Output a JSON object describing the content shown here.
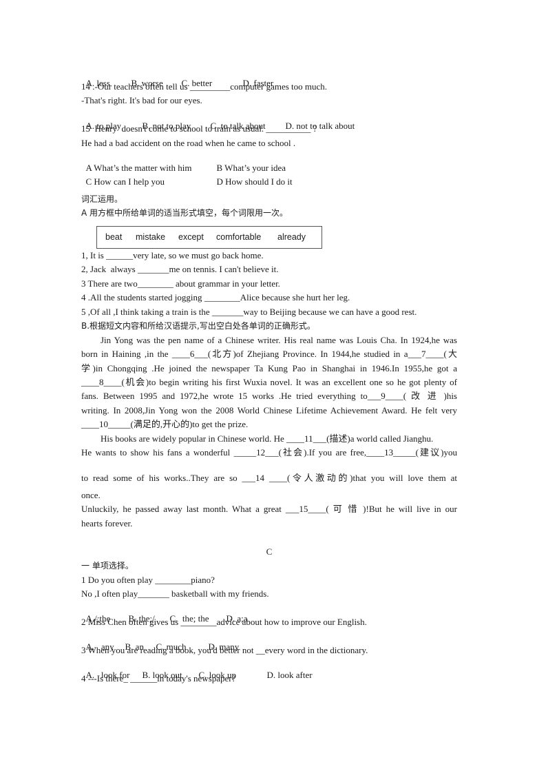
{
  "section_prev": {
    "q13_options": [
      "A. less",
      "B. worse",
      "C. better",
      "D. faster"
    ],
    "q14": {
      "question": "14 .-Our teachers often tell us _________computer games too much.",
      "response": "-That's right. It's bad for our eyes.",
      "options": [
        "A. to play",
        "B. not to play",
        "C .to talk about",
        "D. not to talk about"
      ]
    },
    "q15": {
      "question": "15  Henry  doesn't come to school to train as usual. __________ ?",
      "response": "He had a bad accident on the road when he came to school .",
      "options": [
        "A What’s the matter with him",
        "B What’s your idea",
        "C How can I help you",
        "D How should I do it"
      ]
    }
  },
  "vocab": {
    "heading": "词汇运用。",
    "partA_instruction": "A 用方框中所给单词的适当形式填空，每个词限用一次。",
    "word_box": [
      "beat",
      "mistake",
      "except",
      "comfortable",
      "already"
    ],
    "items": [
      "1, It is ______very late, so we must go back home.",
      "2, Jack  always _______me on tennis. I can't believe it.",
      "3 There are two________ about grammar in your letter.",
      "4 .All the students started jogging ________Alice because she hurt her leg.",
      "5 ,Of all ,I think taking a train is the _______way to Beijing because we can have a good rest."
    ],
    "partB_instruction": "B.根据短文内容和所给汉语提示,写出空白处各单词的正确形式。",
    "passage_lines": [
      "Jin Yong was the pen name of a Chinese writer. His real name was Louis Cha. In 1924,he was",
      "born in Haining ,in the ____6___(北方)of Zhejiang Province. In 1944,he studied in a___7____(大",
      "学)in Chongqing .He joined the newspaper Ta Kung Pao in Shanghai in 1946.In 1955,he got a",
      "____8____(机会)to begin writing his first Wuxia novel. It was an excellent one so he got plenty of",
      "fans. Between 1995 and 1972,he wrote 15 works .He tried everything to___9____( 改 进 )his",
      "writing. In 2008,Jin Yong won the 2008 World Chinese Lifetime Achievement Award. He felt very",
      "____10_____(满足的,开心的)to get the prize.",
      "His books are widely popular in Chinese world. He ____11___(描述)a world called Jianghu.",
      "He wants to show his fans a wonderful _____12___(社会).If you are free,____13_____(建议)you",
      "to read some of his works..They are so ___14        ____(令人激动的)that you will love them at",
      "once.",
      "Unluckily, he passed away last month. What a great ___15____( 可 惜 )!But he will live in our",
      "hearts forever."
    ]
  },
  "sectionC": {
    "label": "C",
    "heading": "一 单项选择。",
    "questions": [
      {
        "lines": [
          "1 Do you often play ________piano?",
          "No ,I often play_______ basketball with my friends."
        ],
        "options": [
          "A./;the",
          "B. the;/",
          "C.  the; the",
          "D. a;a"
        ]
      },
      {
        "lines": [
          "2 Miss Chen often gives us ________advice about how to improve our English."
        ],
        "options": [
          "A.   any",
          "B. an",
          "C. much",
          "D. many"
        ]
      },
      {
        "lines": [
          "3 When you are reading a book, you'd better not __every word in the dictionary."
        ],
        "options": [
          "A.   look for",
          "B. look out",
          "C. look up",
          "D. look after"
        ]
      },
      {
        "lines": [
          "4 ---Is there_ ______in today's newspaper?"
        ],
        "options": []
      }
    ]
  }
}
